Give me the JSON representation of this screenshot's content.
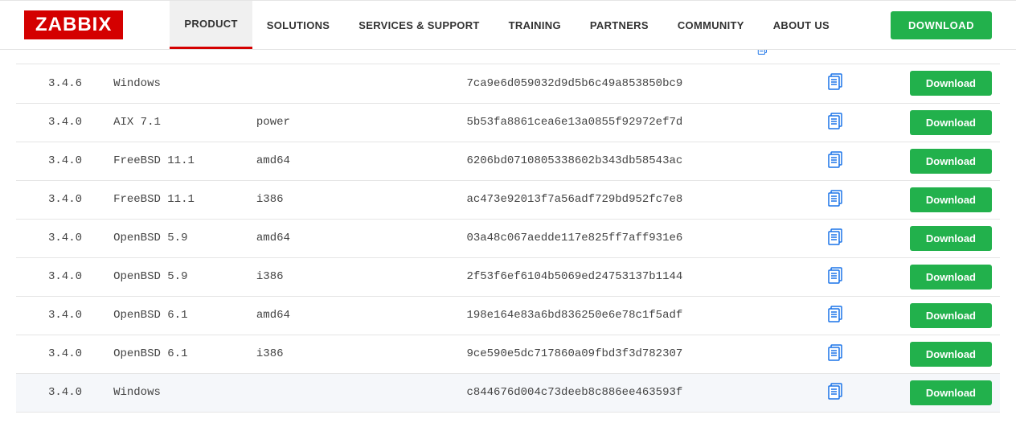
{
  "logo_text": "ZABBIX",
  "nav": {
    "items": [
      {
        "label": "PRODUCT",
        "active": true
      },
      {
        "label": "SOLUTIONS"
      },
      {
        "label": "SERVICES & SUPPORT"
      },
      {
        "label": "TRAINING"
      },
      {
        "label": "PARTNERS"
      },
      {
        "label": "COMMUNITY"
      },
      {
        "label": "ABOUT US"
      }
    ]
  },
  "download_top_label": "DOWNLOAD",
  "download_btn_label": "Download",
  "rows": [
    {
      "version": "3.4.6",
      "os": "Windows",
      "arch": "",
      "hash": "7ca9e6d059032d9d5b6c49a853850bc9"
    },
    {
      "version": "3.4.0",
      "os": "AIX 7.1",
      "arch": "power",
      "hash": "5b53fa8861cea6e13a0855f92972ef7d"
    },
    {
      "version": "3.4.0",
      "os": "FreeBSD 11.1",
      "arch": "amd64",
      "hash": "6206bd0710805338602b343db58543ac"
    },
    {
      "version": "3.4.0",
      "os": "FreeBSD 11.1",
      "arch": "i386",
      "hash": "ac473e92013f7a56adf729bd952fc7e8"
    },
    {
      "version": "3.4.0",
      "os": "OpenBSD 5.9",
      "arch": "amd64",
      "hash": "03a48c067aedde117e825ff7aff931e6"
    },
    {
      "version": "3.4.0",
      "os": "OpenBSD 5.9",
      "arch": "i386",
      "hash": "2f53f6ef6104b5069ed24753137b1144"
    },
    {
      "version": "3.4.0",
      "os": "OpenBSD 6.1",
      "arch": "amd64",
      "hash": "198e164e83a6bd836250e6e78c1f5adf"
    },
    {
      "version": "3.4.0",
      "os": "OpenBSD 6.1",
      "arch": "i386",
      "hash": "9ce590e5dc717860a09fbd3f3d782307"
    },
    {
      "version": "3.4.0",
      "os": "Windows",
      "arch": "",
      "hash": "c844676d004c73deeb8c886ee463593f",
      "highlight": true
    }
  ]
}
